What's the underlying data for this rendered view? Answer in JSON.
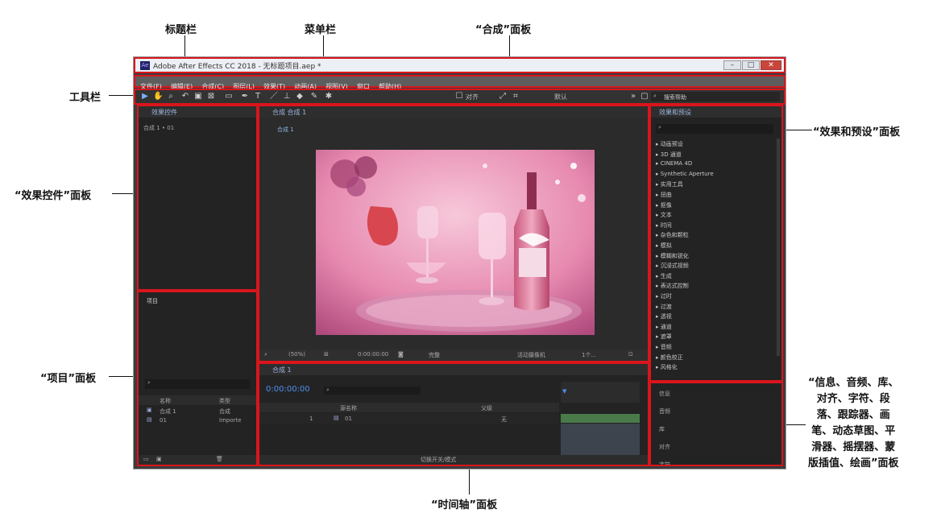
{
  "callouts": {
    "title_bar": "标题栏",
    "menu_bar": "菜单栏",
    "composition_panel": "“合成”面板",
    "tools_bar": "工具栏",
    "effects_presets_panel": "“效果和预设”面板",
    "effect_controls_panel": "“效果控件”面板",
    "project_panel": "“项目”面板",
    "other_panels_line1": "“信息、音频、库、",
    "other_panels_line2": "对齐、字符、段",
    "other_panels_line3": "落、跟踪器、画",
    "other_panels_line4": "笔、动态草图、平",
    "other_panels_line5": "滑器、摇摆器、蒙",
    "other_panels_line6": "版插值、绘画”面板",
    "timeline_panel": "“时间轴”面板"
  },
  "window": {
    "title": "Adobe After Effects CC 2018 - 无标题项目.aep *",
    "logo": "Ae",
    "minimize": "–",
    "maximize": "□",
    "close": "✕"
  },
  "menu": [
    "文件(F)",
    "编辑(E)",
    "合成(C)",
    "图层(L)",
    "效果(T)",
    "动画(A)",
    "视图(V)",
    "窗口",
    "帮助(H)"
  ],
  "toolbar": {
    "snap_label": "对齐",
    "workspace": "默认",
    "search_placeholder": "搜索帮助"
  },
  "effect_controls": {
    "title": "效果控件",
    "layer": "合成 1 • 01"
  },
  "project": {
    "title": "项目",
    "col_name": "名称",
    "col_type": "类型",
    "rows": [
      {
        "name": "合成 1",
        "type": "合成"
      },
      {
        "name": "01",
        "type": "Importe"
      }
    ]
  },
  "composition": {
    "title": "合成 合成 1",
    "tab": "合成 1",
    "zoom": "(50%)",
    "timecode": "0:00:00:00",
    "resolution": "完整",
    "camera": "活动摄像机",
    "views": "1个..."
  },
  "effects_presets": {
    "title": "效果和预设",
    "items": [
      "动画预设",
      "3D 通道",
      "CINEMA 4D",
      "Synthetic Aperture",
      "实用工具",
      "扭曲",
      "抠像",
      "文本",
      "时间",
      "杂色和颗粒",
      "模拟",
      "模糊和锐化",
      "沉浸式视频",
      "生成",
      "表达式控制",
      "过时",
      "过渡",
      "透视",
      "通道",
      "遮罩",
      "音频",
      "颜色校正",
      "风格化"
    ]
  },
  "side_panels": [
    "信息",
    "音频",
    "库",
    "对齐",
    "字符"
  ],
  "timeline": {
    "title": "合成 1",
    "timecode": "0:00:00:00",
    "col_source": "源名称",
    "col_parent": "父级",
    "layer_num": "1",
    "layer_name": "01",
    "parent_value": "无",
    "footer": "切换开关/模式"
  }
}
